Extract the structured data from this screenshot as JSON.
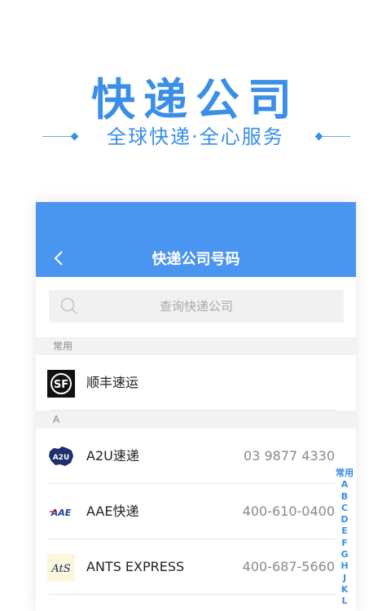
{
  "promo": {
    "title": "快递公司",
    "subtitle": "全球快递·全心服务"
  },
  "colors": {
    "accent": "#3a8ee8",
    "nav_bar": "#4a95ef",
    "section_bg": "#f2f2f2"
  },
  "nav": {
    "title": "快递公司号码",
    "back_icon": "chevron-left-icon"
  },
  "search": {
    "placeholder": "查询快递公司",
    "icon": "search-icon"
  },
  "sections": [
    {
      "header": "常用",
      "items": [
        {
          "name": "顺丰速运",
          "phone": "",
          "logo": "sf-logo"
        }
      ]
    },
    {
      "header": "A",
      "items": [
        {
          "name": "A2U速递",
          "phone": "03 9877 4330",
          "logo": "a2u-logo"
        },
        {
          "name": "AAE快递",
          "phone": "400-610-0400",
          "logo": "aae-logo"
        },
        {
          "name": "ANTS EXPRESS",
          "phone": "400-687-5660",
          "logo": "ats-logo"
        }
      ]
    }
  ],
  "index_bar": [
    "常用",
    "A",
    "B",
    "C",
    "D",
    "E",
    "F",
    "G",
    "H",
    "J",
    "K",
    "L"
  ]
}
